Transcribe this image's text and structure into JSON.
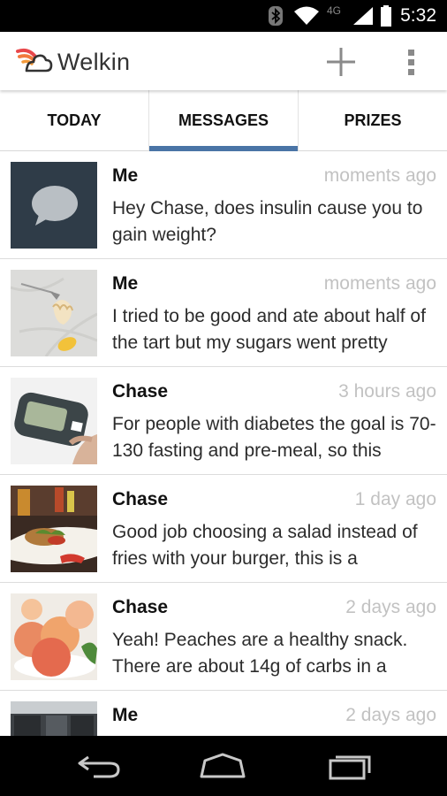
{
  "status_bar": {
    "time": "5:32",
    "network_label": "4G",
    "icons": [
      "bluetooth-icon",
      "wifi-icon",
      "signal-icon",
      "battery-icon"
    ]
  },
  "app_bar": {
    "title": "Welkin",
    "logo": "welkin-cloud-logo",
    "actions": [
      "add-icon",
      "overflow-menu-icon"
    ]
  },
  "tabs": [
    {
      "label": "TODAY",
      "active": false
    },
    {
      "label": "MESSAGES",
      "active": true
    },
    {
      "label": "PRIZES",
      "active": false
    }
  ],
  "messages": [
    {
      "sender": "Me",
      "time": "moments ago",
      "preview": "Hey Chase, does insulin cause you to gain weight?",
      "thumbnail": "chat-bubble-icon"
    },
    {
      "sender": "Me",
      "time": "moments ago",
      "preview": "I tried to be good and ate about half of the tart but my sugars went pretty",
      "thumbnail": "tart-photo"
    },
    {
      "sender": "Chase",
      "time": "3 hours ago",
      "preview": "For people with diabetes the goal is 70-130 fasting and pre-meal, so this",
      "thumbnail": "glucose-meter-photo"
    },
    {
      "sender": "Chase",
      "time": "1 day ago",
      "preview": "Good job choosing a salad instead of fries with your burger, this is a",
      "thumbnail": "burger-salad-photo"
    },
    {
      "sender": "Chase",
      "time": "2 days ago",
      "preview": "Yeah! Peaches are a healthy snack. There are about 14g of carbs in a",
      "thumbnail": "peaches-photo"
    },
    {
      "sender": "Me",
      "time": "2 days ago",
      "preview": "",
      "thumbnail": "kitchen-photo"
    }
  ],
  "colors": {
    "accent": "#4a74a6",
    "timestamp": "#c2c2c2",
    "logo_red": "#e8484b",
    "logo_orange": "#f39a3b"
  },
  "nav_bar": [
    "back-icon",
    "home-icon",
    "recents-icon"
  ]
}
